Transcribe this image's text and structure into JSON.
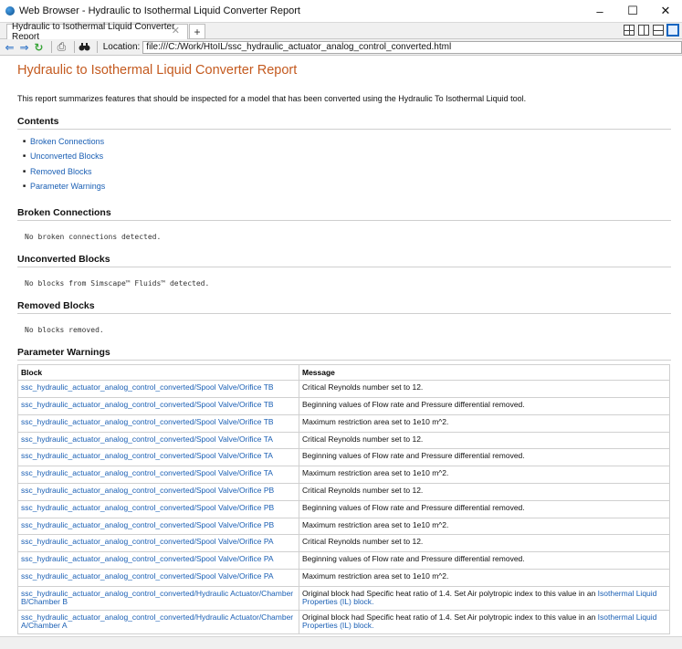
{
  "window": {
    "title": "Web Browser - Hydraulic to Isothermal Liquid Converter Report",
    "controls": {
      "minimize": "–",
      "maximize": "☐",
      "close": "✕"
    }
  },
  "tabs": [
    {
      "label": "Hydraulic to Isothermal Liquid Converter Report",
      "close": "✕",
      "active": true
    }
  ],
  "new_tab_label": "+",
  "layout_icons": [
    "grid-layout-icon",
    "vertical-split-icon",
    "horizontal-split-icon",
    "single-pane-icon"
  ],
  "toolbar": {
    "icons": [
      "back-arrow-icon",
      "forward-arrow-icon",
      "refresh-icon",
      "print-icon",
      "find-icon"
    ],
    "location_label": "Location:",
    "location_value": "file:///C:/Work/HtoIL/ssc_hydraulic_actuator_analog_control_converted.html"
  },
  "report": {
    "title": "Hydraulic to Isothermal Liquid Converter Report",
    "intro": "This report summarizes features that should be inspected for a model that has been converted using the Hydraulic To Isothermal Liquid tool.",
    "contents_heading": "Contents",
    "contents": [
      "Broken Connections",
      "Unconverted Blocks",
      "Removed Blocks",
      "Parameter Warnings"
    ],
    "broken_heading": "Broken Connections",
    "broken_text": "No broken connections detected.",
    "unconverted_heading": "Unconverted Blocks",
    "unconverted_text": "No blocks from Simscape™ Fluids™ detected.",
    "removed_heading": "Removed Blocks",
    "removed_text": "No blocks removed.",
    "param_heading": "Parameter Warnings",
    "table_headers": {
      "block": "Block",
      "message": "Message"
    },
    "rows": [
      {
        "block": "ssc_hydraulic_actuator_analog_control_converted/Spool Valve/Orifice TB",
        "message": "Critical Reynolds number set to 12."
      },
      {
        "block": "ssc_hydraulic_actuator_analog_control_converted/Spool Valve/Orifice TB",
        "message": "Beginning values of Flow rate and Pressure differential removed."
      },
      {
        "block": "ssc_hydraulic_actuator_analog_control_converted/Spool Valve/Orifice TB",
        "message": "Maximum restriction area set to 1e10 m^2."
      },
      {
        "block": "ssc_hydraulic_actuator_analog_control_converted/Spool Valve/Orifice TA",
        "message": "Critical Reynolds number set to 12."
      },
      {
        "block": "ssc_hydraulic_actuator_analog_control_converted/Spool Valve/Orifice TA",
        "message": "Beginning values of Flow rate and Pressure differential removed."
      },
      {
        "block": "ssc_hydraulic_actuator_analog_control_converted/Spool Valve/Orifice TA",
        "message": "Maximum restriction area set to 1e10 m^2."
      },
      {
        "block": "ssc_hydraulic_actuator_analog_control_converted/Spool Valve/Orifice PB",
        "message": "Critical Reynolds number set to 12."
      },
      {
        "block": "ssc_hydraulic_actuator_analog_control_converted/Spool Valve/Orifice PB",
        "message": "Beginning values of Flow rate and Pressure differential removed."
      },
      {
        "block": "ssc_hydraulic_actuator_analog_control_converted/Spool Valve/Orifice PB",
        "message": "Maximum restriction area set to 1e10 m^2."
      },
      {
        "block": "ssc_hydraulic_actuator_analog_control_converted/Spool Valve/Orifice PA",
        "message": "Critical Reynolds number set to 12."
      },
      {
        "block": "ssc_hydraulic_actuator_analog_control_converted/Spool Valve/Orifice PA",
        "message": "Beginning values of Flow rate and Pressure differential removed."
      },
      {
        "block": "ssc_hydraulic_actuator_analog_control_converted/Spool Valve/Orifice PA",
        "message": "Maximum restriction area set to 1e10 m^2."
      },
      {
        "block": "ssc_hydraulic_actuator_analog_control_converted/Hydraulic Actuator/Chamber B/Chamber B",
        "message": "Original block had Specific heat ratio of 1.4. Set Air polytropic index to this value in an ",
        "link": "Isothermal Liquid Properties (IL) block",
        "suffix": "."
      },
      {
        "block": "ssc_hydraulic_actuator_analog_control_converted/Hydraulic Actuator/Chamber A/Chamber A",
        "message": "Original block had Specific heat ratio of 1.4. Set Air polytropic index to this value in an ",
        "link": "Isothermal Liquid Properties (IL) block",
        "suffix": "."
      }
    ]
  }
}
